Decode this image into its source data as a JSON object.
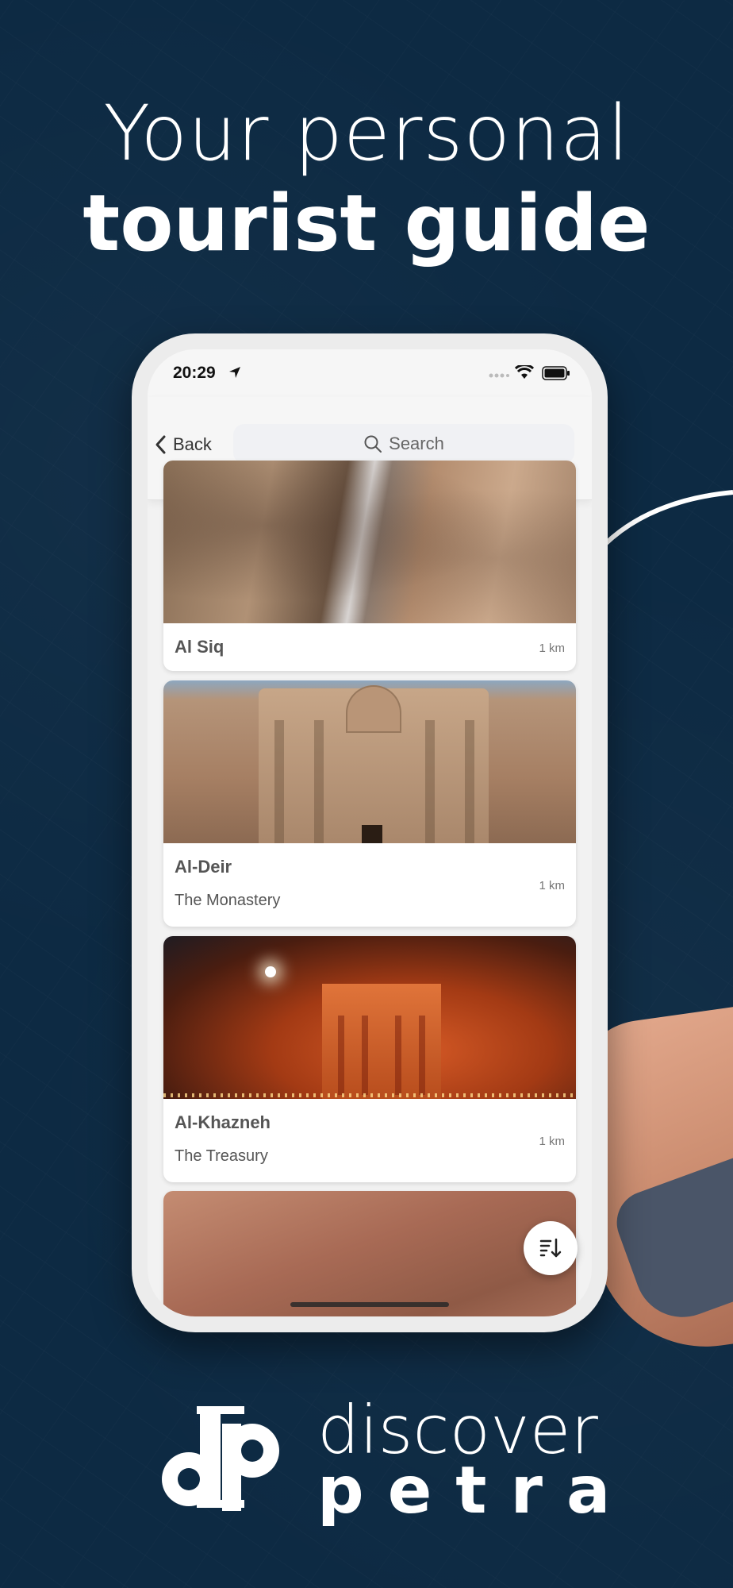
{
  "headline": {
    "line1": "Your personal",
    "line2": "tourist guide"
  },
  "status_bar": {
    "time": "20:29"
  },
  "nav": {
    "back_label": "Back",
    "search_placeholder": "Search"
  },
  "places": [
    {
      "title": "Al Siq",
      "subtitle": "",
      "distance": "1 km"
    },
    {
      "title": "Al-Deir",
      "subtitle": "The Monastery",
      "distance": "1 km"
    },
    {
      "title": "Al-Khazneh",
      "subtitle": "The Treasury",
      "distance": "1 km"
    }
  ],
  "brand": {
    "name_line1": "discover",
    "name_line2": "petra",
    "logo_letters": "dp"
  },
  "colors": {
    "background": "#0d2a43",
    "accent_white": "#ffffff"
  },
  "icons": {
    "back": "chevron-left-icon",
    "search": "search-icon",
    "sort": "sort-descending-icon",
    "location": "location-arrow-icon",
    "wifi": "wifi-icon",
    "battery": "battery-icon"
  }
}
